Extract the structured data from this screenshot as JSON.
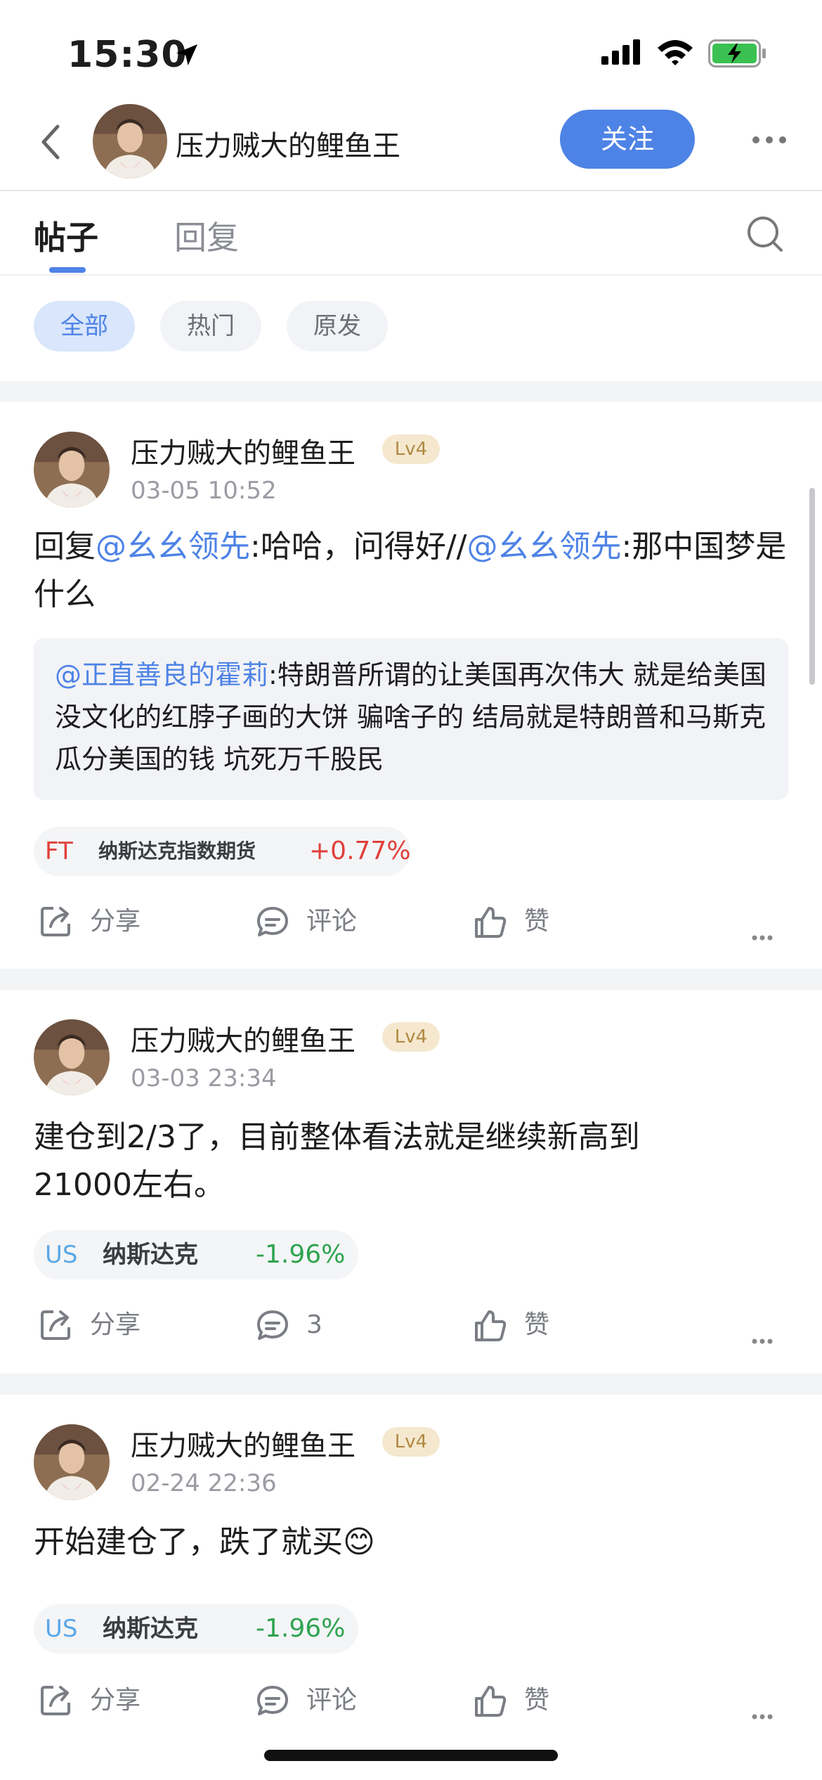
{
  "status_bar": {
    "time": "15:30"
  },
  "header": {
    "profile_name": "压力贼大的鲤鱼王",
    "follow_label": "关注"
  },
  "tabs": [
    {
      "label": "帖子"
    },
    {
      "label": "回复"
    }
  ],
  "filters": [
    {
      "label": "全部"
    },
    {
      "label": "热门"
    },
    {
      "label": "原发"
    }
  ],
  "posts": [
    {
      "author": "压力贼大的鲤鱼王",
      "level": "Lv4",
      "time": "03-05 10:52",
      "text": {
        "prefix": "回复",
        "mention1": "@幺幺领先",
        "part1": ":哈哈，问得好//",
        "mention2": "@幺幺领先",
        "part2": ":那中国梦是什么"
      },
      "quote": {
        "mention": "@正直善良的霍莉",
        "text": ":特朗普所谓的让美国再次伟大 就是给美国没文化的红脖子画的大饼 骗啥子的 结局就是特朗普和马斯克瓜分美国的钱 坑死万千股民"
      },
      "stock": {
        "market": "FT",
        "name": "纳斯达克指数期货",
        "change": "+0.77%",
        "market_color": "#e0403a",
        "change_color": "#e0403a"
      },
      "actions": {
        "share": "分享",
        "comment": "评论",
        "like": "赞"
      }
    },
    {
      "author": "压力贼大的鲤鱼王",
      "level": "Lv4",
      "time": "03-03 23:34",
      "text": {
        "body": "建仓到2/3了，目前整体看法就是继续新高到21000左右。"
      },
      "stock": {
        "market": "US",
        "name": "纳斯达克",
        "change": "-1.96%",
        "market_color": "#5aa8e8",
        "change_color": "#2ea44f"
      },
      "actions": {
        "share": "分享",
        "comment": "3",
        "like": "赞"
      }
    },
    {
      "author": "压力贼大的鲤鱼王",
      "level": "Lv4",
      "time": "02-24 22:36",
      "text": {
        "body": "开始建仓了，跌了就买😊"
      },
      "stock": {
        "market": "US",
        "name": "纳斯达克",
        "change": "-1.96%",
        "market_color": "#5aa8e8",
        "change_color": "#2ea44f"
      },
      "actions": {
        "share": "分享",
        "comment": "评论",
        "like": "赞"
      }
    }
  ],
  "colors": {
    "accent": "#4e83e6",
    "up": "#e0403a",
    "down": "#2ea44f"
  }
}
